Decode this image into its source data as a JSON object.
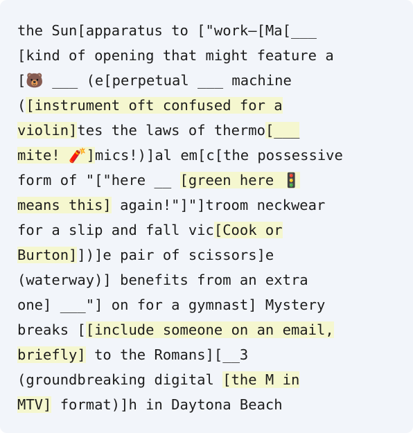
{
  "colors": {
    "card_background": "#f2f5fa",
    "highlight": "#f5f7cf",
    "text": "#1c1c1c"
  },
  "puzzle": {
    "segments": [
      {
        "text": "the Sun[apparatus to [\"work–[Ma[___\n[kind of opening that might feature a\n[🐻 ___ (e[perpetual ___ machine\n(",
        "highlight": false
      },
      {
        "text": "[instrument oft confused for a\nviolin]",
        "highlight": true
      },
      {
        "text": "tes the laws of thermo",
        "highlight": false
      },
      {
        "text": "[___\nmite! 🧨]",
        "highlight": true
      },
      {
        "text": "mics!)]al em[c[the possessive\nform of \"[\"here __ ",
        "highlight": false
      },
      {
        "text": "[green here 🚦\nmeans this]",
        "highlight": true
      },
      {
        "text": " again!\"]\"]troom neckwear\nfor a slip and fall vic",
        "highlight": false
      },
      {
        "text": "[Cook or\nBurton]",
        "highlight": true
      },
      {
        "text": "])]e pair of scissors]e\n(waterway)] benefits from an extra\none] ___\"] on for a gymnast] Mystery\nbreaks [",
        "highlight": false
      },
      {
        "text": "[include someone on an email,\nbriefly]",
        "highlight": true
      },
      {
        "text": " to the Romans][__3\n(groundbreaking digital ",
        "highlight": false
      },
      {
        "text": "[the M in\nMTV]",
        "highlight": true
      },
      {
        "text": " format)]h in Daytona Beach",
        "highlight": false
      }
    ]
  }
}
